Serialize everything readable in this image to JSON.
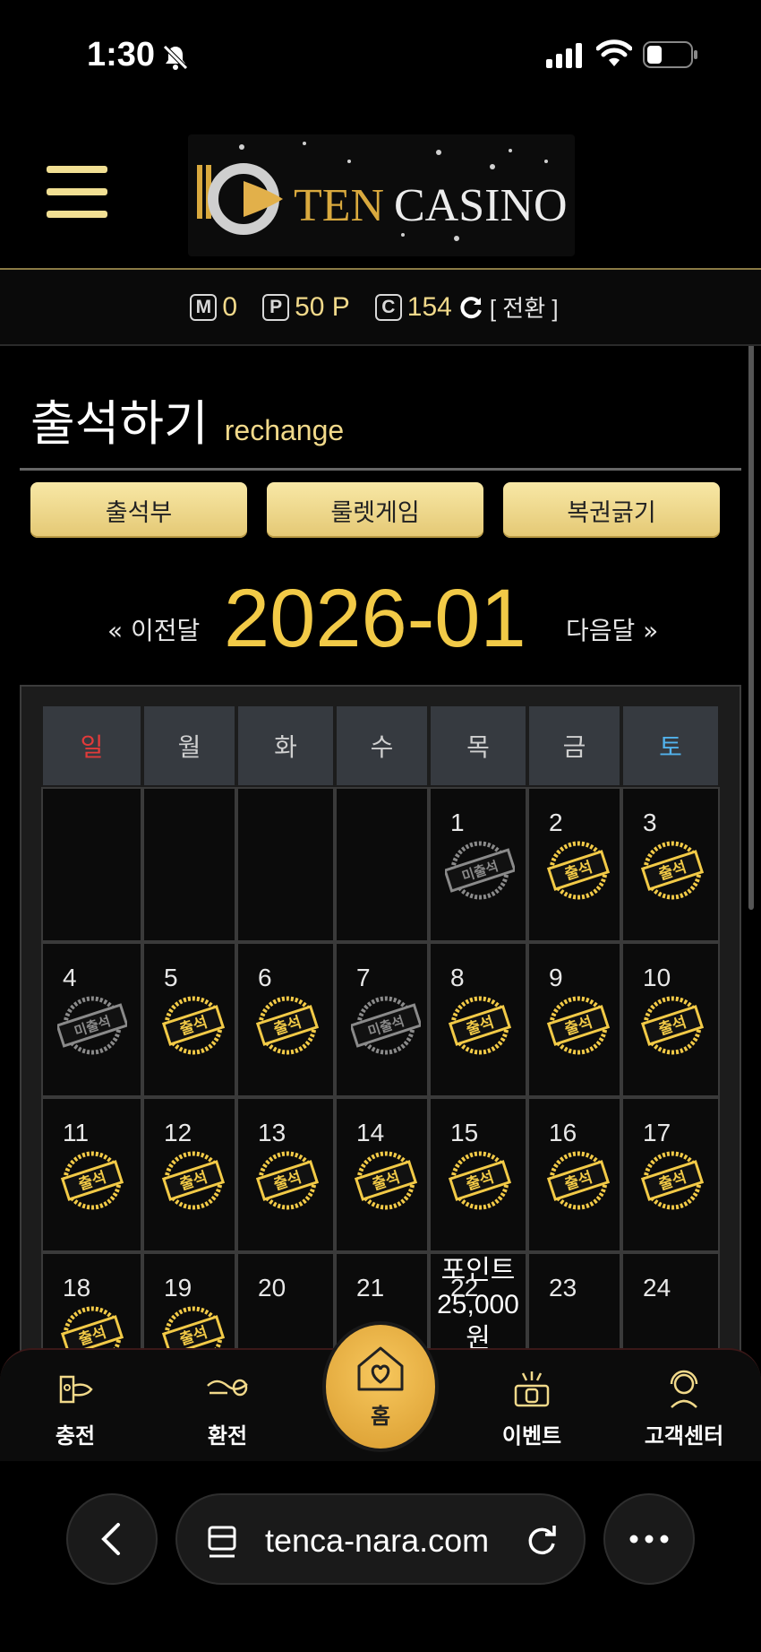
{
  "status": {
    "time": "1:30"
  },
  "header": {
    "logo_text": "TEN CASINO"
  },
  "points": {
    "m_label": "M",
    "m_value": "0",
    "p_label": "P",
    "p_value": "50 P",
    "c_label": "C",
    "c_value": "154",
    "convert": "[ 전환 ]"
  },
  "page": {
    "title": "출석하기",
    "subtitle": "rechange"
  },
  "tabs": [
    "출석부",
    "룰렛게임",
    "복권긁기"
  ],
  "month_nav": {
    "prev": "« 이전달",
    "current": "2026-01",
    "next": "다음달 »"
  },
  "calendar": {
    "weekdays": [
      "일",
      "월",
      "화",
      "수",
      "목",
      "금",
      "토"
    ],
    "stamp_attend": "출석",
    "stamp_absent": "미출석",
    "weeks": [
      [
        {
          "day": "",
          "s": ""
        },
        {
          "day": "",
          "s": ""
        },
        {
          "day": "",
          "s": ""
        },
        {
          "day": "",
          "s": ""
        },
        {
          "day": "1",
          "s": "absent"
        },
        {
          "day": "2",
          "s": "attend"
        },
        {
          "day": "3",
          "s": "attend"
        }
      ],
      [
        {
          "day": "4",
          "s": "absent"
        },
        {
          "day": "5",
          "s": "attend"
        },
        {
          "day": "6",
          "s": "attend"
        },
        {
          "day": "7",
          "s": "absent"
        },
        {
          "day": "8",
          "s": "attend"
        },
        {
          "day": "9",
          "s": "attend"
        },
        {
          "day": "10",
          "s": "attend"
        }
      ],
      [
        {
          "day": "11",
          "s": "attend"
        },
        {
          "day": "12",
          "s": "attend"
        },
        {
          "day": "13",
          "s": "attend"
        },
        {
          "day": "14",
          "s": "attend"
        },
        {
          "day": "15",
          "s": "attend"
        },
        {
          "day": "16",
          "s": "attend"
        },
        {
          "day": "17",
          "s": "attend"
        }
      ],
      [
        {
          "day": "18",
          "s": "attend"
        },
        {
          "day": "19",
          "s": "attend"
        },
        {
          "day": "20",
          "s": ""
        },
        {
          "day": "21",
          "s": ""
        },
        {
          "day": "22",
          "s": "",
          "prize": "포인트 25,000 원"
        },
        {
          "day": "23",
          "s": ""
        },
        {
          "day": "24",
          "s": ""
        }
      ]
    ]
  },
  "nav": {
    "charge": "충전",
    "exchange": "환전",
    "home": "홈",
    "event": "이벤트",
    "support": "고객센터"
  },
  "browser": {
    "url": "tenca-nara.com"
  },
  "colors": {
    "gold": "#f2ca47",
    "tab_gold": "#f1df93",
    "sunday": "#e23a3a",
    "saturday": "#52b2ec"
  }
}
